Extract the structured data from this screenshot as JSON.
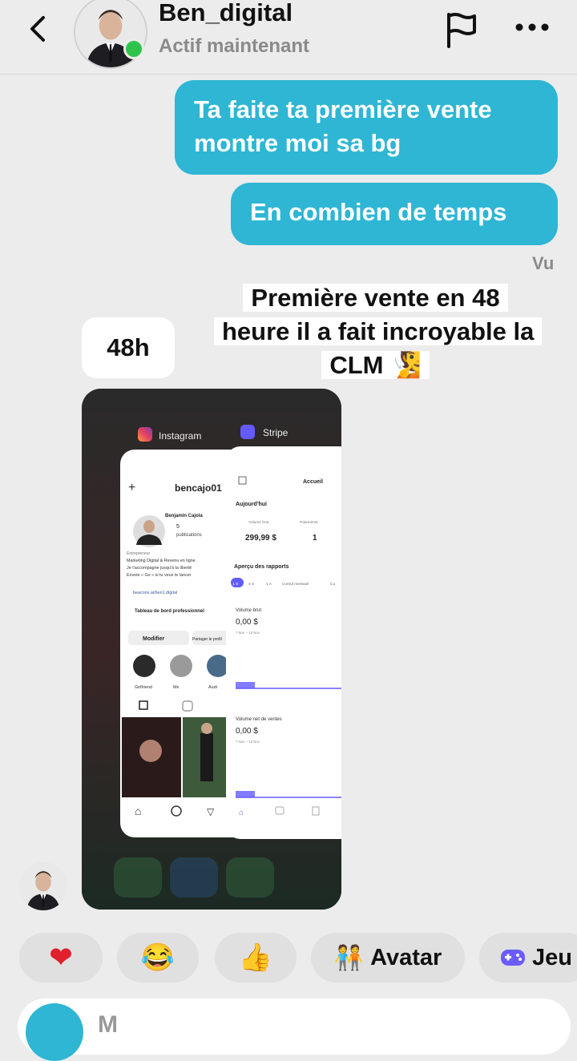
{
  "header": {
    "username": "Ben_digital",
    "status": "Actif maintenant"
  },
  "messages": {
    "sent_1": "Ta faite ta première vente montre moi sa bg",
    "sent_2": "En combien de temps",
    "seen_label": "Vu",
    "received_1": "48h"
  },
  "overlay_caption": "Première vente en 48 heure il a fait incroyable la CLM 🧏",
  "shared_image": {
    "instagram_app_label": "Instagram",
    "stripe_app_label": "Stripe",
    "ig_username": "bencajo01",
    "ig_name": "Benjamin Cajola",
    "ig_posts": "5",
    "ig_posts_label": "publications",
    "ig_bio_1": "Entrepreneur",
    "ig_bio_2": "Marketing Digital & Revenu en ligne",
    "ig_bio_3": "Je t'accompagne jusqu'à ta liberté",
    "ig_bio_4": "Envoie « Go » si tu veux te lancer",
    "ig_link": "beacons.ai/ben1.digital",
    "ig_dashboard": "Tableau de bord professionnel",
    "ig_edit_btn": "Modifier",
    "ig_share_btn": "Partager le profil",
    "ig_highlights": [
      "Girlfriend",
      "Me",
      "Audi"
    ],
    "stripe_title": "Accueil",
    "stripe_today": "Aujourd'hui",
    "stripe_gross_label": "Volume brut",
    "stripe_gross_value": "299,99 $",
    "stripe_payments_label": "Paiements",
    "stripe_payments_value": "1",
    "stripe_reports": "Aperçu des rapports",
    "stripe_ranges": [
      "1 S",
      "4 S",
      "1 A",
      "Cumul mensuel",
      "Cu"
    ],
    "stripe_brut_label": "Volume brut",
    "stripe_brut_value": "0,00 $",
    "stripe_brut_dates": "7 Nov. – 13 Nov.",
    "stripe_net_label": "Volume net de ventes",
    "stripe_net_value": "0,00 $",
    "stripe_net_dates": "7 Nov. – 13 Nov."
  },
  "quick_replies": {
    "avatar": "Avatar",
    "games": "Jeu"
  },
  "composer": {
    "placeholder": "M"
  },
  "colors": {
    "sent_bubble": "#2eb6d4",
    "online_dot": "#2ec44b",
    "stripe_accent": "#635bff"
  }
}
